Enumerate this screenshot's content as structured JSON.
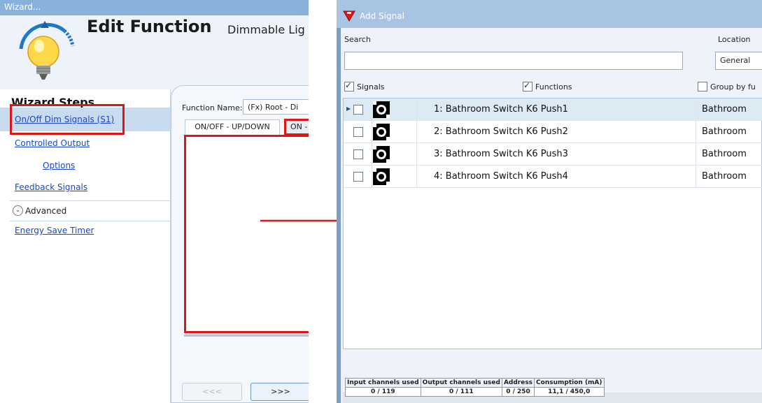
{
  "wizard": {
    "window_title": "Wizard...",
    "heading": "Edit Function",
    "subtitle": "Dimmable Lig",
    "steps_header": "Wizard Steps",
    "steps": [
      {
        "label": "On/Off Dim Signals (S1)"
      },
      {
        "label": "Controlled Output"
      },
      {
        "label": "Options"
      },
      {
        "label": "Feedback Signals"
      }
    ],
    "advanced_label": "Advanced",
    "advanced_steps": [
      {
        "label": "Energy Save Timer"
      }
    ],
    "function_name_label": "Function Name:",
    "function_name_value": "(Fx) Root - Di",
    "tabs": [
      {
        "label": "ON/OFF - UP/DOWN"
      },
      {
        "label": "ON -"
      }
    ],
    "prev_button": "<<<",
    "next_button": ">>>"
  },
  "add_signal": {
    "window_title": "Add Signal",
    "search_label": "Search",
    "search_value": "",
    "location_label": "Location",
    "location_selected": "General",
    "filters": {
      "signals": {
        "label": "Signals",
        "checked": true
      },
      "functions": {
        "label": "Functions",
        "checked": true
      },
      "group_by": {
        "label": "Group by fu",
        "checked": false
      }
    },
    "rows": [
      {
        "name": "1: Bathroom Switch K6 Push1",
        "location": "Bathroom",
        "selected": true
      },
      {
        "name": "2: Bathroom Switch K6 Push2",
        "location": "Bathroom",
        "selected": false
      },
      {
        "name": "3: Bathroom Switch K6 Push3",
        "location": "Bathroom",
        "selected": false
      },
      {
        "name": "4: Bathroom Switch K6 Push4",
        "location": "Bathroom",
        "selected": false
      }
    ],
    "status": {
      "headers": [
        "Input channels used",
        "Output channels used",
        "Address",
        "Consumption (mA)"
      ],
      "values": [
        "0 / 119",
        "0 / 111",
        "0 / 250",
        "11,1 / 450,0"
      ]
    }
  },
  "colors": {
    "highlight_red": "#e01616",
    "link_blue": "#1a48c8",
    "selected_row": "#dbeaf3",
    "titlebar_blue": "#8ab0dc"
  },
  "icons": [
    "bulb-icon",
    "add-signal-icon",
    "pushbutton-icon",
    "chevron-down-icon",
    "arrow-right-icon"
  ]
}
